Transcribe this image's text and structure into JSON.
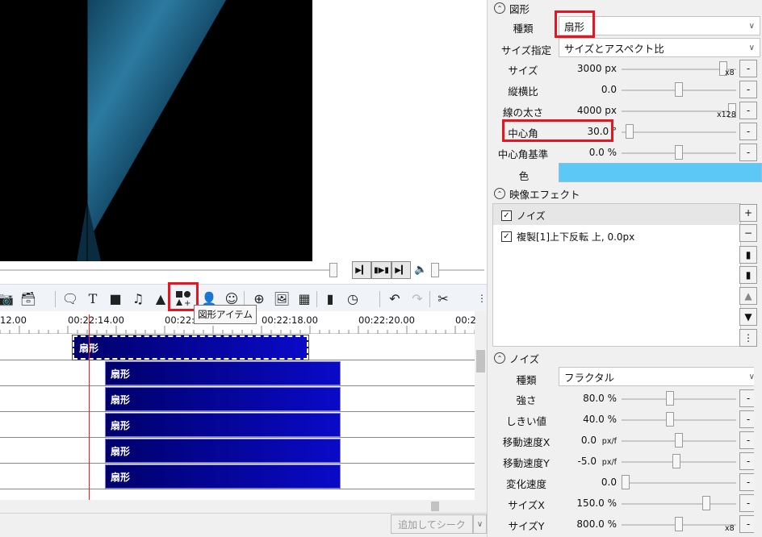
{
  "preview": {
    "controls": {
      "play_label": "▶▎",
      "step_label": "▮▶▮",
      "end_label": "▶▎",
      "volume_icon": "speaker-icon"
    }
  },
  "toolbar": {
    "tooltip": "図形アイテム"
  },
  "timeline": {
    "ruler_labels": [
      "12.00",
      "00:22:14.00",
      "00:22:1",
      "00:22:18.00",
      "00:22:20.00",
      "00:2"
    ],
    "clips": [
      {
        "label": "扇形",
        "selected": true
      },
      {
        "label": "扇形"
      },
      {
        "label": "扇形"
      },
      {
        "label": "扇形"
      },
      {
        "label": "扇形"
      },
      {
        "label": "扇形"
      }
    ],
    "seek_button": "追加してシーク",
    "seek_dropdown": "∨"
  },
  "shape_section": {
    "title": "図形",
    "type_label": "種類",
    "type_value": "扇形",
    "size_spec_label": "サイズ指定",
    "size_spec_value": "サイズとアスペクト比",
    "params": [
      {
        "label": "サイズ",
        "value": "3000 px",
        "suffix": "x8",
        "fraction": 0.92
      },
      {
        "label": "縦横比",
        "value": "0.0",
        "suffix": "",
        "fraction": 0.5
      },
      {
        "label": "線の太さ",
        "value": "4000 px",
        "suffix": "x128",
        "fraction": 1.0
      },
      {
        "label": "中心角",
        "value": "30.0 °",
        "suffix": "",
        "fraction": 0.04
      },
      {
        "label": "中心角基準",
        "value": "0.0 %",
        "suffix": "",
        "fraction": 0.5
      }
    ],
    "color_label": "色",
    "color_value": "#5bc8f5",
    "minus": "-"
  },
  "effects_section": {
    "title": "映像エフェクト",
    "items": [
      {
        "label": "ノイズ",
        "checked": true
      },
      {
        "label": "複製[1]上下反転 上, 0.0px",
        "checked": true
      }
    ],
    "side_buttons": [
      "+",
      "−",
      "▮",
      "▮",
      "▲",
      "▼",
      "⋮"
    ]
  },
  "noise_section": {
    "title": "ノイズ",
    "type_label": "種類",
    "type_value": "フラクタル",
    "params": [
      {
        "label": "強さ",
        "value": "80.0 %",
        "unit": "",
        "fraction": 0.42
      },
      {
        "label": "しきい値",
        "value": "40.0 %",
        "unit": "",
        "fraction": 0.42
      },
      {
        "label": "移動速度X",
        "value": "0.0",
        "unit": "px/f",
        "fraction": 0.5
      },
      {
        "label": "移動速度Y",
        "value": "-5.0",
        "unit": "px/f",
        "fraction": 0.48
      },
      {
        "label": "変化速度",
        "value": "0.0",
        "unit": "",
        "fraction": 0.0
      },
      {
        "label": "サイズX",
        "value": "150.0 %",
        "unit": "",
        "fraction": 0.76
      },
      {
        "label": "サイズY",
        "value": "800.0 %",
        "unit": "",
        "suffix": "x8",
        "fraction": 0.5
      }
    ]
  }
}
